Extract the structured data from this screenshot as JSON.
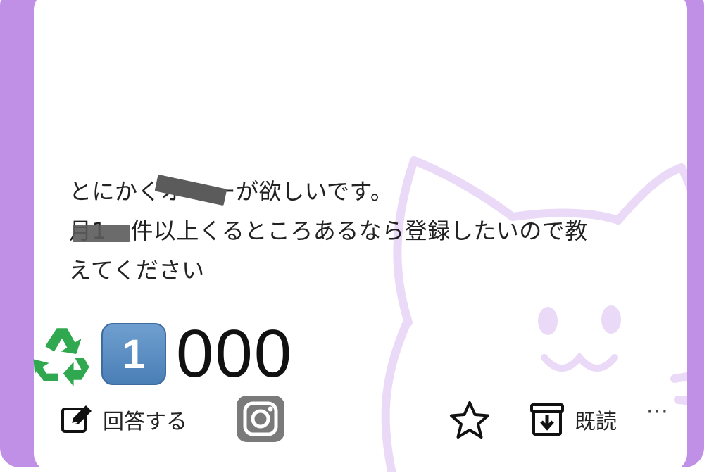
{
  "post": {
    "line1_a": "とにかくオ",
    "line1_b": "ーが欲しいです。",
    "line2_a": "月1",
    "line2_b": "件以上くるところあるなら登録したいので教",
    "line3": "えてください"
  },
  "counter": {
    "keycap_digit": "1",
    "text": "000",
    "recycle_icon": "recycle-icon"
  },
  "toolbar": {
    "answer_label": "回答する",
    "read_label": "既読",
    "more_label": "···"
  },
  "colors": {
    "frame": "#c08fe6",
    "watermark": "#ead9f7",
    "keycap": "#5b8ec4"
  }
}
